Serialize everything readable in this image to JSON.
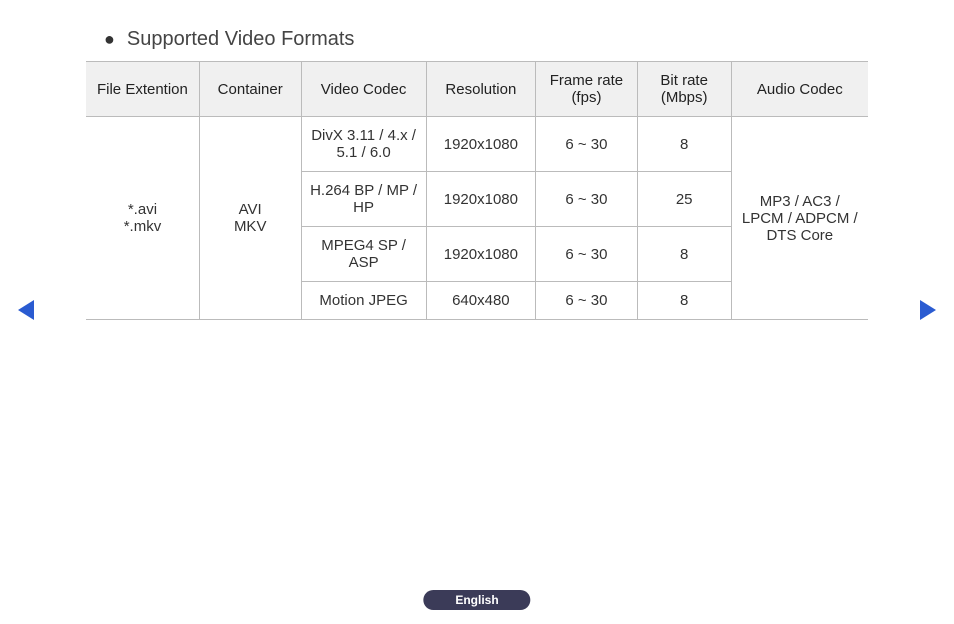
{
  "title": "Supported Video Formats",
  "language": "English",
  "table": {
    "headers": {
      "file_ext": "File Extention",
      "container": "Container",
      "video_codec": "Video Codec",
      "resolution": "Resolution",
      "frame_rate": "Frame rate (fps)",
      "bit_rate": "Bit rate (Mbps)",
      "audio_codec": "Audio Codec"
    },
    "group": {
      "file_ext_1": "*.avi",
      "file_ext_2": "*.mkv",
      "container_1": "AVI",
      "container_2": "MKV",
      "audio_codec": "MP3 / AC3 / LPCM / ADPCM / DTS Core"
    },
    "rows": [
      {
        "video_codec": "DivX 3.11 / 4.x / 5.1 / 6.0",
        "resolution": "1920x1080",
        "frame_rate": "6 ~ 30",
        "bit_rate": "8"
      },
      {
        "video_codec": "H.264 BP / MP / HP",
        "resolution": "1920x1080",
        "frame_rate": "6 ~ 30",
        "bit_rate": "25"
      },
      {
        "video_codec": "MPEG4 SP / ASP",
        "resolution": "1920x1080",
        "frame_rate": "6 ~ 30",
        "bit_rate": "8"
      },
      {
        "video_codec": "Motion JPEG",
        "resolution": "640x480",
        "frame_rate": "6 ~ 30",
        "bit_rate": "8"
      }
    ]
  },
  "chart_data": {
    "type": "table",
    "title": "Supported Video Formats",
    "columns": [
      "File Extention",
      "Container",
      "Video Codec",
      "Resolution",
      "Frame rate (fps)",
      "Bit rate (Mbps)",
      "Audio Codec"
    ],
    "rows": [
      [
        "*.avi *.mkv",
        "AVI MKV",
        "DivX 3.11 / 4.x / 5.1 / 6.0",
        "1920x1080",
        "6 ~ 30",
        8,
        "MP3 / AC3 / LPCM / ADPCM / DTS Core"
      ],
      [
        "*.avi *.mkv",
        "AVI MKV",
        "H.264 BP / MP / HP",
        "1920x1080",
        "6 ~ 30",
        25,
        "MP3 / AC3 / LPCM / ADPCM / DTS Core"
      ],
      [
        "*.avi *.mkv",
        "AVI MKV",
        "MPEG4 SP / ASP",
        "1920x1080",
        "6 ~ 30",
        8,
        "MP3 / AC3 / LPCM / ADPCM / DTS Core"
      ],
      [
        "*.avi *.mkv",
        "AVI MKV",
        "Motion JPEG",
        "640x480",
        "6 ~ 30",
        8,
        "MP3 / AC3 / LPCM / ADPCM / DTS Core"
      ]
    ]
  }
}
